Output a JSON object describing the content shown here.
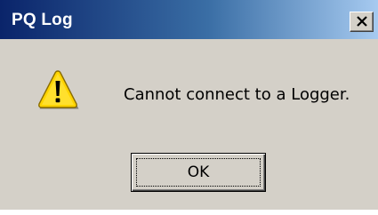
{
  "window": {
    "title": "PQ Log",
    "close_icon": "close-icon",
    "colors": {
      "titlebar_start": "#0a246a",
      "titlebar_end": "#a6caf0",
      "face": "#d4d0c8"
    }
  },
  "message": {
    "icon": "warning-icon",
    "text": "Cannot connect to a Logger."
  },
  "buttons": {
    "ok_label": "OK"
  }
}
